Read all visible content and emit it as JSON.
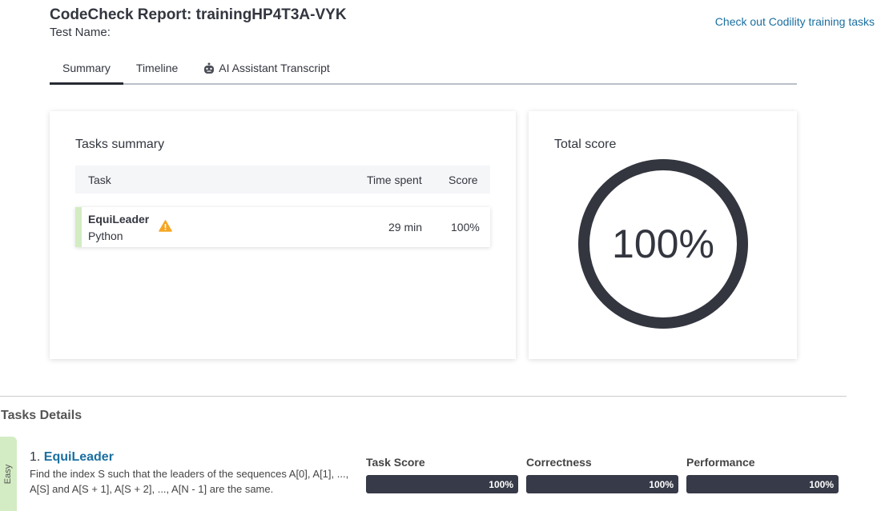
{
  "header": {
    "title": "CodeCheck Report: trainingHP4T3A-VYK",
    "test_name": "Test Name:",
    "training_link": "Check out Codility training tasks"
  },
  "tabs": [
    {
      "label": "Summary",
      "active": true
    },
    {
      "label": "Timeline"
    },
    {
      "label": "AI Assistant Transcript",
      "icon": "robot-icon"
    }
  ],
  "tasks_summary": {
    "title": "Tasks summary",
    "columns": [
      "Task",
      "Time spent",
      "Score"
    ],
    "rows": [
      {
        "name": "EquiLeader",
        "language": "Python",
        "warning_icon": "warning-icon",
        "time": "29 min",
        "score": "100%"
      }
    ]
  },
  "total_score": {
    "title": "Total score",
    "value": "100%",
    "fraction": 1.0
  },
  "details": {
    "title": "Tasks Details",
    "tasks": [
      {
        "difficulty": "Easy",
        "number": "1.",
        "name": "EquiLeader",
        "description": "Find the index S such that the leaders of the sequences A[0], A[1], ..., A[S] and A[S + 1], A[S + 2], ..., A[N - 1] are the same.",
        "metrics": [
          {
            "label": "Task Score",
            "value": "100%"
          },
          {
            "label": "Correctness",
            "value": "100%"
          },
          {
            "label": "Performance",
            "value": "100%"
          }
        ]
      }
    ]
  },
  "colors": {
    "accent": "#1a6fa0",
    "easy": "#d3ecc3",
    "dark": "#33363f",
    "warning": "#f5a623"
  }
}
